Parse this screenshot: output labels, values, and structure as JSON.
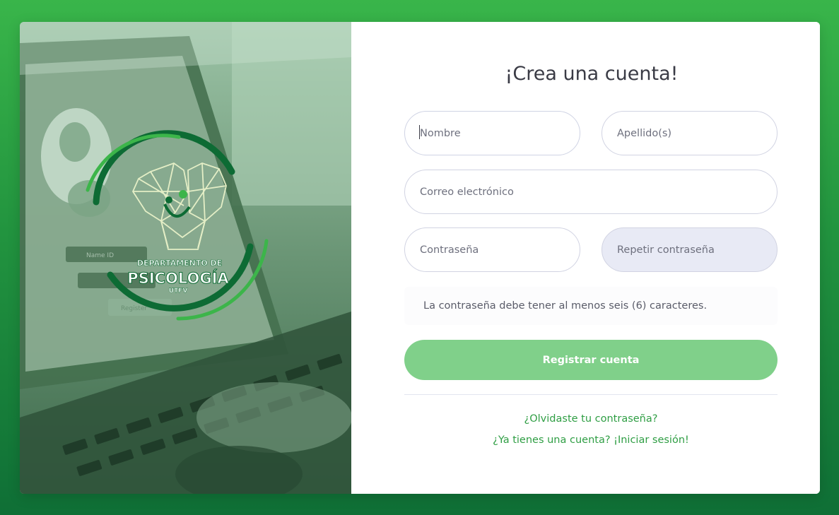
{
  "form": {
    "title": "¡Crea una cuenta!",
    "first_name_placeholder": "Nombre",
    "last_name_placeholder": "Apellido(s)",
    "email_placeholder": "Correo electrónico",
    "password_placeholder": "Contraseña",
    "repeat_password_placeholder": "Repetir contraseña",
    "password_hint": "La contraseña debe tener al menos seis (6) caracteres.",
    "submit_label": "Registrar cuenta",
    "forgot_password_link": "¿Olvidaste tu contraseña?",
    "login_link": "¿Ya tienes una cuenta? ¡Iniciar sesión!"
  },
  "logo": {
    "line1": "DEPARTAMENTO DE",
    "line2": "PSICOLOGÍA",
    "line3": "UTFV"
  },
  "background_screen": {
    "name_field": "Name ID",
    "register_button": "Register"
  },
  "colors": {
    "page_gradient_top": "#39b54a",
    "page_gradient_bottom": "#0f6f36",
    "submit_button": "#80d08a",
    "link": "#2f9e44",
    "logo_dark_green": "#0d6b34",
    "logo_light_green": "#3cb54a"
  }
}
